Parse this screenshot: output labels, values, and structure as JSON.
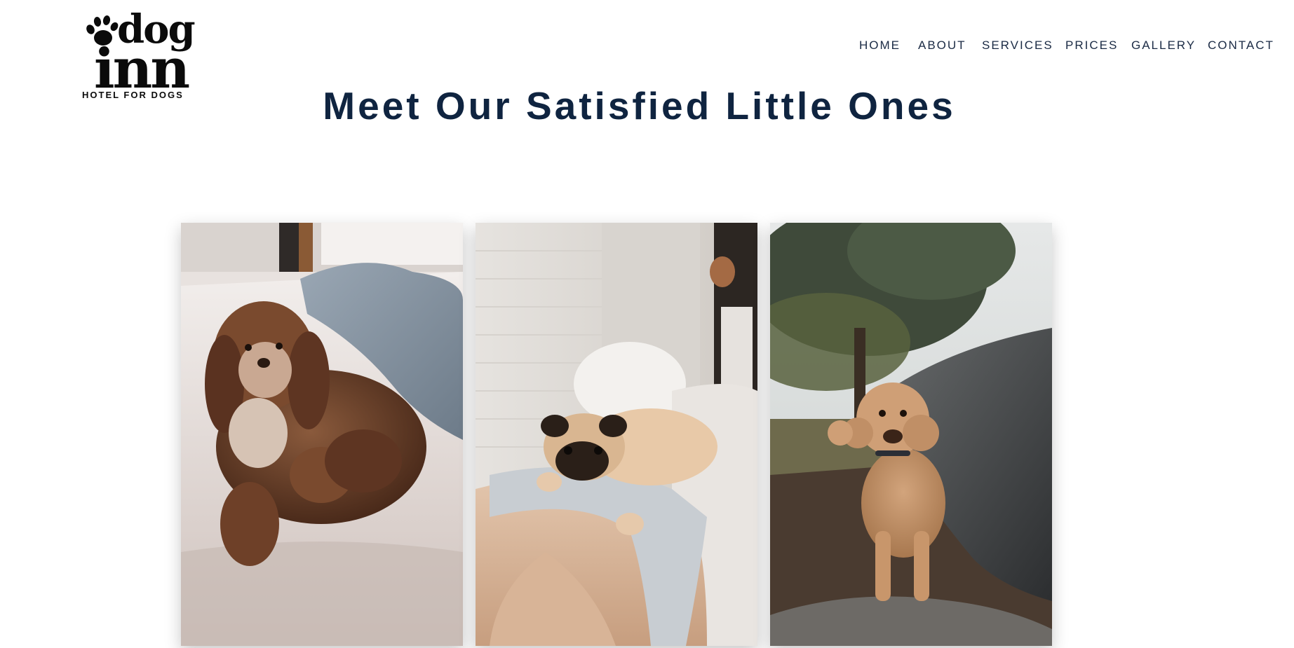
{
  "brand": {
    "logo_top": "dog",
    "logo_bottom": "inn",
    "tagline": "HOTEL FOR DOGS"
  },
  "nav": {
    "items": [
      {
        "label": "HOME"
      },
      {
        "label": "ABOUT"
      },
      {
        "label": "SERVICES"
      },
      {
        "label": "PRICES"
      },
      {
        "label": "GALLERY"
      },
      {
        "label": "CONTACT"
      }
    ]
  },
  "hero": {
    "title": "Meet Our Satisfied Little Ones"
  },
  "gallery": {
    "photos": [
      {
        "icon": "brown-doodle-on-bed-photo"
      },
      {
        "icon": "pug-on-sofa-photo"
      },
      {
        "icon": "poodle-by-rock-wall-photo"
      }
    ]
  },
  "colors": {
    "background": "#ffffff",
    "title": "#0f2440",
    "nav_text": "#1a2a44",
    "logo": "#0b0b0b"
  }
}
